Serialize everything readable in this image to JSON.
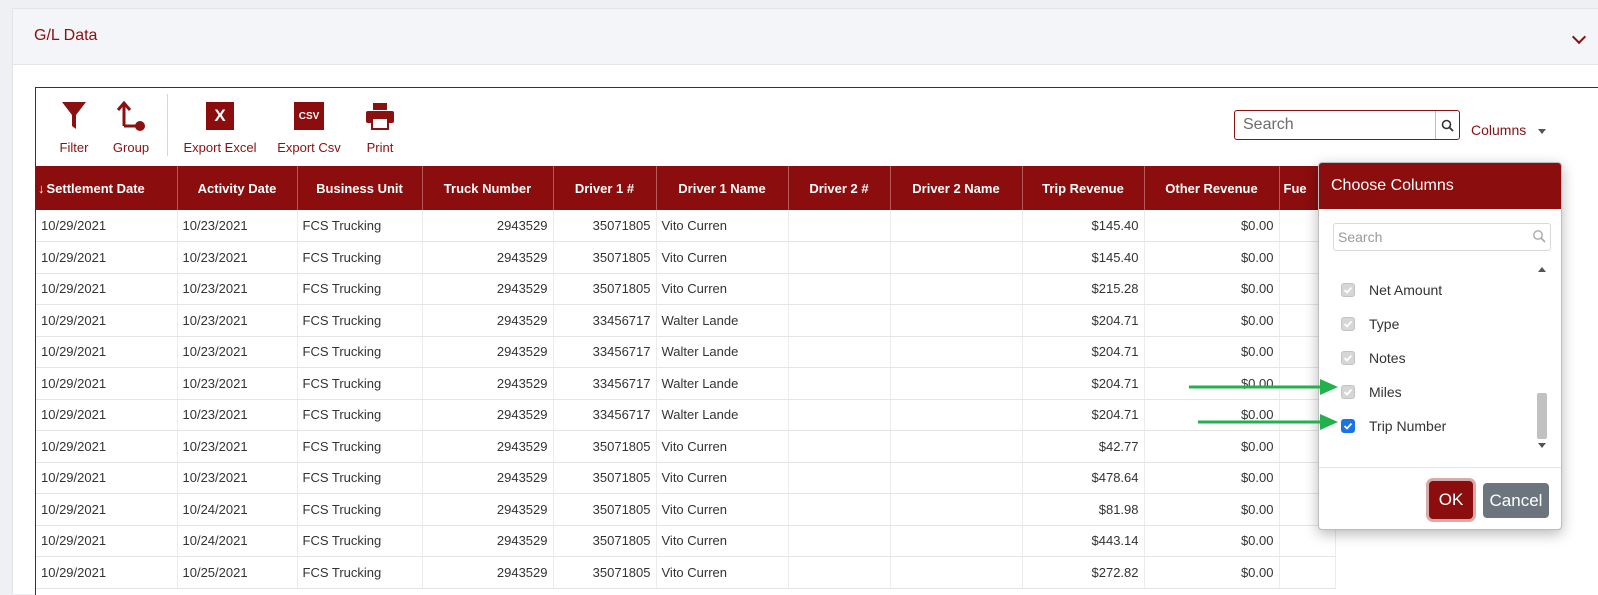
{
  "panel": {
    "title": "G/L Data"
  },
  "toolbar": {
    "filter_label": "Filter",
    "group_label": "Group",
    "export_excel_label": "Export Excel",
    "export_csv_label": "Export Csv",
    "print_label": "Print",
    "excel_glyph": "X",
    "csv_glyph": "CSV",
    "search_placeholder": "Search",
    "columns_label": "Columns"
  },
  "grid": {
    "columns": [
      "Settlement Date",
      "Activity Date",
      "Business Unit",
      "Truck Number",
      "Driver 1 #",
      "Driver 1 Name",
      "Driver 2 #",
      "Driver 2 Name",
      "Trip Revenue",
      "Other Revenue",
      "Fue"
    ],
    "rows": [
      {
        "settlement": "10/29/2021",
        "activity": "10/23/2021",
        "unit": "FCS Trucking",
        "truck": "2943529",
        "driver1": "35071805",
        "driver1_name": "Vito Curren",
        "trip_revenue": "$145.40",
        "other_revenue": "$0.00"
      },
      {
        "settlement": "10/29/2021",
        "activity": "10/23/2021",
        "unit": "FCS Trucking",
        "truck": "2943529",
        "driver1": "35071805",
        "driver1_name": "Vito Curren",
        "trip_revenue": "$145.40",
        "other_revenue": "$0.00"
      },
      {
        "settlement": "10/29/2021",
        "activity": "10/23/2021",
        "unit": "FCS Trucking",
        "truck": "2943529",
        "driver1": "35071805",
        "driver1_name": "Vito Curren",
        "trip_revenue": "$215.28",
        "other_revenue": "$0.00"
      },
      {
        "settlement": "10/29/2021",
        "activity": "10/23/2021",
        "unit": "FCS Trucking",
        "truck": "2943529",
        "driver1": "33456717",
        "driver1_name": "Walter Lande",
        "trip_revenue": "$204.71",
        "other_revenue": "$0.00"
      },
      {
        "settlement": "10/29/2021",
        "activity": "10/23/2021",
        "unit": "FCS Trucking",
        "truck": "2943529",
        "driver1": "33456717",
        "driver1_name": "Walter Lande",
        "trip_revenue": "$204.71",
        "other_revenue": "$0.00"
      },
      {
        "settlement": "10/29/2021",
        "activity": "10/23/2021",
        "unit": "FCS Trucking",
        "truck": "2943529",
        "driver1": "33456717",
        "driver1_name": "Walter Lande",
        "trip_revenue": "$204.71",
        "other_revenue": "$0.00"
      },
      {
        "settlement": "10/29/2021",
        "activity": "10/23/2021",
        "unit": "FCS Trucking",
        "truck": "2943529",
        "driver1": "33456717",
        "driver1_name": "Walter Lande",
        "trip_revenue": "$204.71",
        "other_revenue": "$0.00"
      },
      {
        "settlement": "10/29/2021",
        "activity": "10/23/2021",
        "unit": "FCS Trucking",
        "truck": "2943529",
        "driver1": "35071805",
        "driver1_name": "Vito Curren",
        "trip_revenue": "$42.77",
        "other_revenue": "$0.00"
      },
      {
        "settlement": "10/29/2021",
        "activity": "10/23/2021",
        "unit": "FCS Trucking",
        "truck": "2943529",
        "driver1": "35071805",
        "driver1_name": "Vito Curren",
        "trip_revenue": "$478.64",
        "other_revenue": "$0.00"
      },
      {
        "settlement": "10/29/2021",
        "activity": "10/24/2021",
        "unit": "FCS Trucking",
        "truck": "2943529",
        "driver1": "35071805",
        "driver1_name": "Vito Curren",
        "trip_revenue": "$81.98",
        "other_revenue": "$0.00"
      },
      {
        "settlement": "10/29/2021",
        "activity": "10/24/2021",
        "unit": "FCS Trucking",
        "truck": "2943529",
        "driver1": "35071805",
        "driver1_name": "Vito Curren",
        "trip_revenue": "$443.14",
        "other_revenue": "$0.00"
      },
      {
        "settlement": "10/29/2021",
        "activity": "10/25/2021",
        "unit": "FCS Trucking",
        "truck": "2943529",
        "driver1": "35071805",
        "driver1_name": "Vito Curren",
        "trip_revenue": "$272.82",
        "other_revenue": "$0.00"
      }
    ]
  },
  "choose_columns": {
    "title": "Choose Columns",
    "search_placeholder": "Search",
    "items": [
      {
        "label": "Net Amount",
        "state": "disabled"
      },
      {
        "label": "Type",
        "state": "disabled"
      },
      {
        "label": "Notes",
        "state": "disabled"
      },
      {
        "label": "Miles",
        "state": "disabled"
      },
      {
        "label": "Trip Number",
        "state": "checked"
      }
    ],
    "ok_label": "OK",
    "cancel_label": "Cancel"
  },
  "colors": {
    "brand": "#8b0d0d",
    "annotation_arrow": "#22b14c",
    "checkbox_checked": "#1a73e8"
  }
}
